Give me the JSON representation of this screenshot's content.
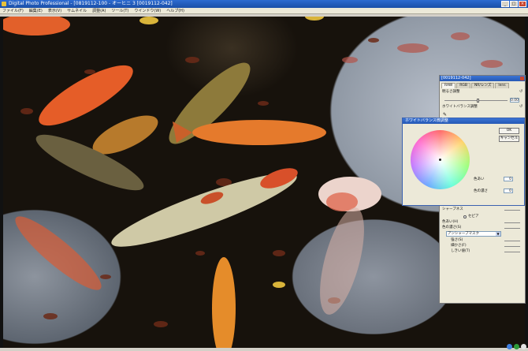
{
  "window": {
    "title": "Digital Photo Professional - [0819112-100 - オーヒニ 3 [0019112-042]",
    "minimize": "_",
    "maximize": "□",
    "close": "×"
  },
  "menu": [
    "ファイル(F)",
    "編集(E)",
    "表示(V)",
    "サムネイル",
    "調整(A)",
    "ツール(T)",
    "ウインドウ(W)",
    "ヘルプ(H)"
  ],
  "palette": {
    "title": "[0019112-042]",
    "tabs": [
      "RAW",
      "RGB",
      "NR/レンズ",
      "lens"
    ],
    "brightness_label": "明るさ調整",
    "brightness_value": "0.00",
    "wb_label": "ホワイトバランス調整",
    "sharpness_label": "シャープネス",
    "monochrome_label": "モノクロ",
    "sepia_label": "セピア",
    "hue_label": "色あい(H)",
    "saturation_label": "色の濃さ(S)",
    "unsharp_option": "アンシャープマスク",
    "strength_label": "強さ(S)",
    "fineness_label": "細かさ(F)",
    "threshold_label": "しきい値(T)"
  },
  "dialog": {
    "title": "ホワイトバランス微調整",
    "ok_label": "OK",
    "cancel_label": "キャンセル",
    "hue_label": "色あい",
    "hue_value": "0",
    "saturation_label": "色の濃さ",
    "saturation_value": "0"
  },
  "colors": {
    "titlebar": "#2558b5",
    "panel": "#ece9d8",
    "koi_orange": "#e8652a",
    "koi_olive": "#8a7a3a"
  }
}
